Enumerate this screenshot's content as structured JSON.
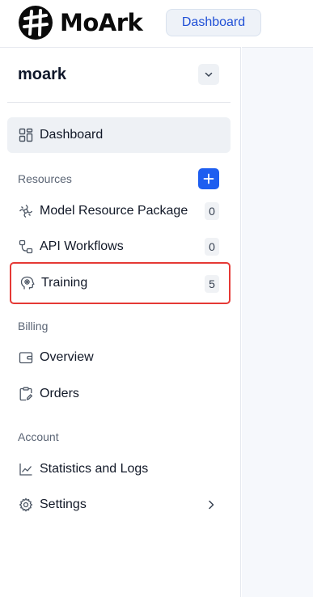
{
  "header": {
    "logo_text": "MoArk",
    "dashboard_button": "Dashboard"
  },
  "sidebar": {
    "org_name": "moark",
    "dashboard": {
      "label": "Dashboard",
      "icon": "grid-icon"
    },
    "sections": {
      "resources": "Resources",
      "billing": "Billing",
      "account": "Account"
    },
    "resources": [
      {
        "label": "Model Resource Package",
        "count": "0",
        "icon": "model-package-icon"
      },
      {
        "label": "API Workflows",
        "count": "0",
        "icon": "workflow-icon"
      },
      {
        "label": "Training",
        "count": "5",
        "icon": "training-icon"
      }
    ],
    "billing": [
      {
        "label": "Overview",
        "icon": "wallet-icon"
      },
      {
        "label": "Orders",
        "icon": "clipboard-icon"
      }
    ],
    "account": [
      {
        "label": "Statistics and Logs",
        "icon": "line-chart-icon"
      },
      {
        "label": "Settings",
        "icon": "gear-icon"
      }
    ]
  },
  "colors": {
    "accent": "#1e5ef0",
    "highlight_border": "#e53935",
    "active_bg": "#eef1f5"
  }
}
